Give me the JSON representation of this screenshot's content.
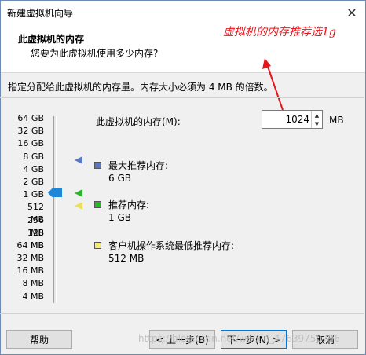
{
  "window": {
    "title": "新建虚拟机向导",
    "close_icon": "close-icon"
  },
  "header": {
    "title": "此虚拟机的内存",
    "subtitle": "您要为此虚拟机使用多少内存?"
  },
  "annotation": {
    "text": "虚拟机的内存推荐选1g",
    "color": "#e8141b"
  },
  "instruction": "指定分配给此虚拟机的内存量。内存大小必须为 4 MB 的倍数。",
  "scale": [
    "64 GB",
    "32 GB",
    "16 GB",
    "8 GB",
    "4 GB",
    "2 GB",
    "1 GB",
    "512 MB",
    "256 MB",
    "128 MB",
    "64 MB",
    "32 MB",
    "16 MB",
    "8 MB",
    "4 MB"
  ],
  "memory": {
    "label": "此虚拟机的内存(M):",
    "value": "1024",
    "unit": "MB"
  },
  "legend": {
    "max_label": "最大推荐内存:",
    "max_value": "6 GB",
    "rec_label": "推荐内存:",
    "rec_value": "1 GB",
    "min_label": "客户机操作系统最低推荐内存:",
    "min_value": "512 MB"
  },
  "colors": {
    "max": "#5a78c0",
    "recommended": "#2ab52a",
    "minimum": "#f3ea70",
    "thumb": "#1e86d6"
  },
  "buttons": {
    "help": "帮助",
    "back": "< 上一步(B)",
    "next": "下一步(N) >",
    "cancel": "取消"
  },
  "watermark": "https://blog.csdn.net/weixin_47639750796"
}
